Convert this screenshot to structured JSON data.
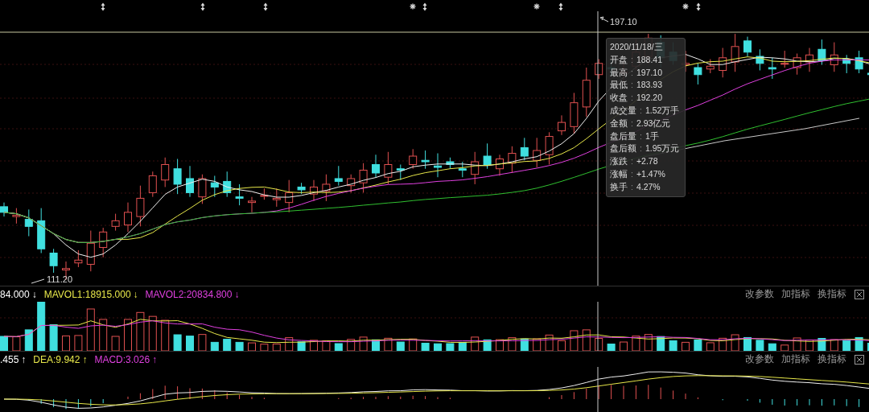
{
  "main_chart": {
    "high_label": "197.10",
    "low_label": "111.20",
    "event_markers": [
      {
        "kind": "arrow"
      },
      {
        "kind": "arrow"
      },
      {
        "kind": "arrow"
      },
      {
        "kind": "star"
      },
      {
        "kind": "arrow"
      },
      {
        "kind": "star"
      },
      {
        "kind": "arrow"
      },
      {
        "kind": "star"
      },
      {
        "kind": "arrow"
      }
    ],
    "tooltip": {
      "date": "2020/11/18/三",
      "separator": ":",
      "rows": [
        {
          "label": "开盘",
          "value": "188.41"
        },
        {
          "label": "最高",
          "value": "197.10"
        },
        {
          "label": "最低",
          "value": "183.93"
        },
        {
          "label": "收盘",
          "value": "192.20"
        },
        {
          "label": "成交量",
          "value": "1.52万手"
        },
        {
          "label": "金额",
          "value": "2.93亿元"
        },
        {
          "label": "盘后量",
          "value": "1手"
        },
        {
          "label": "盘后额",
          "value": "1.95万元"
        },
        {
          "label": "涨跌",
          "value": "+2.78"
        },
        {
          "label": "涨幅",
          "value": "+1.47%"
        },
        {
          "label": "换手",
          "value": "4.27%"
        }
      ]
    }
  },
  "panes": [
    {
      "legend": [
        {
          "text": "84.000",
          "arrow": "↓",
          "color": "#ffffff"
        },
        {
          "text": "MAVOL1:18915.000",
          "arrow": "↓",
          "color": "#e8e84a"
        },
        {
          "text": "MAVOL2:20834.800",
          "arrow": "↓",
          "color": "#e040e0"
        }
      ],
      "buttons": [
        "改参数",
        "加指标",
        "换指标"
      ]
    },
    {
      "legend": [
        {
          "text": ".455",
          "arrow": "↑",
          "color": "#ffffff"
        },
        {
          "text": "DEA:9.942",
          "arrow": "↑",
          "color": "#e8e84a"
        },
        {
          "text": "MACD:3.026",
          "arrow": "↑",
          "color": "#e040e0"
        }
      ],
      "buttons": [
        "改参数",
        "加指标",
        "换指标"
      ]
    }
  ]
}
